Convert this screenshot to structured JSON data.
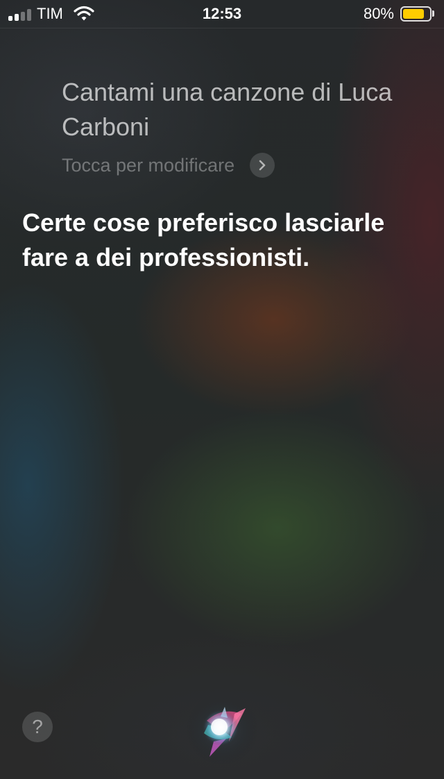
{
  "status_bar": {
    "carrier": "TIM",
    "signal_bars_filled": 2,
    "signal_bars_total": 4,
    "time": "12:53",
    "battery_percent_text": "80%",
    "battery_level": 0.8,
    "battery_fill_color": "#ffcc00",
    "wifi_icon": "wifi-icon"
  },
  "siri": {
    "query": "Cantami una canzone di Luca Carboni",
    "edit_hint": "Tocca per modificare",
    "edit_icon": "chevron-right-icon",
    "response": "Certe cose preferisco lasciarle fare a dei professionisti.",
    "help_label": "?",
    "orb_icon": "siri-orb-icon"
  }
}
